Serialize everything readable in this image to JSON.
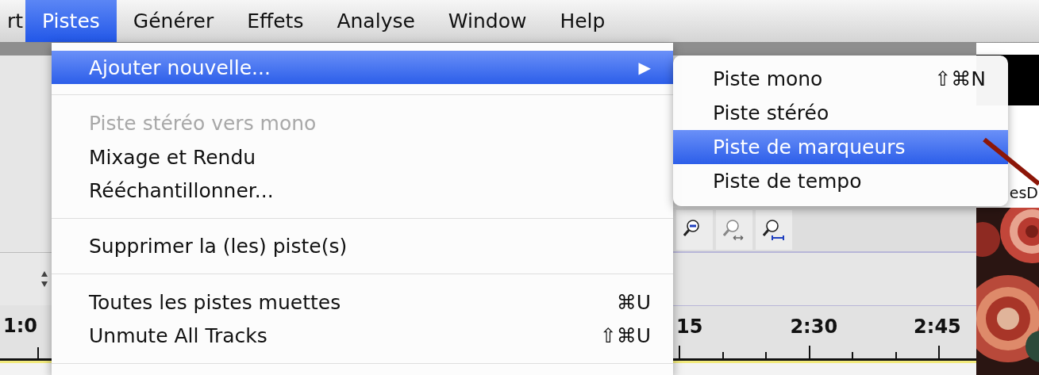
{
  "menubar": {
    "items": [
      {
        "label": "rt",
        "selected": false
      },
      {
        "label": "Pistes",
        "selected": true
      },
      {
        "label": "Générer",
        "selected": false
      },
      {
        "label": "Effets",
        "selected": false
      },
      {
        "label": "Analyse",
        "selected": false
      },
      {
        "label": "Window",
        "selected": false
      },
      {
        "label": "Help",
        "selected": false
      }
    ]
  },
  "menu": {
    "items": [
      {
        "kind": "item",
        "label": "Ajouter nouvelle...",
        "submenu_arrow": "▶",
        "selected": true,
        "disabled": false
      },
      {
        "kind": "separator"
      },
      {
        "kind": "item",
        "label": "Piste stéréo vers mono",
        "selected": false,
        "disabled": true
      },
      {
        "kind": "item",
        "label": "Mixage et Rendu",
        "selected": false,
        "disabled": false
      },
      {
        "kind": "item",
        "label": "Rééchantillonner...",
        "selected": false,
        "disabled": false
      },
      {
        "kind": "separator"
      },
      {
        "kind": "item",
        "label": "Supprimer la (les) piste(s)",
        "selected": false,
        "disabled": false
      },
      {
        "kind": "separator"
      },
      {
        "kind": "item",
        "label": "Toutes les pistes muettes",
        "shortcut": "⌘U",
        "selected": false,
        "disabled": false
      },
      {
        "kind": "item",
        "label": "Unmute All Tracks",
        "shortcut": "⇧⌘U",
        "selected": false,
        "disabled": false
      },
      {
        "kind": "separator"
      }
    ]
  },
  "submenu": {
    "items": [
      {
        "kind": "item",
        "label": "Piste mono",
        "shortcut": "⇧⌘N",
        "selected": false,
        "disabled": false
      },
      {
        "kind": "item",
        "label": "Piste stéréo",
        "selected": false,
        "disabled": false
      },
      {
        "kind": "item",
        "label": "Piste de marqueurs",
        "selected": true,
        "disabled": false
      },
      {
        "kind": "item",
        "label": "Piste de tempo",
        "selected": false,
        "disabled": false
      }
    ]
  },
  "background": {
    "side_label": "esD",
    "ruler": {
      "left_label": "1:0",
      "labels": [
        "15",
        "2:30",
        "2:45"
      ]
    }
  }
}
